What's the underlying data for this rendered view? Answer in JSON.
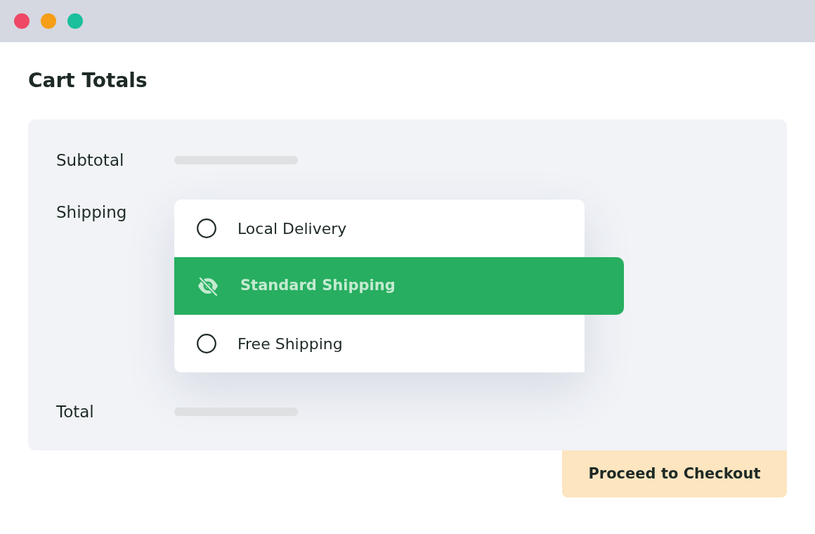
{
  "window": {
    "buttons": [
      {
        "color": "#ee4865"
      },
      {
        "color": "#f59e16"
      },
      {
        "color": "#1abf9c"
      }
    ]
  },
  "heading": "Cart Totals",
  "rows": [
    {
      "kind": "placeholder",
      "label": "Subtotal"
    },
    {
      "kind": "options",
      "label": "Shipping",
      "options": [
        {
          "label": "Local Delivery",
          "selected": false
        },
        {
          "label": "Standard Shipping",
          "selected": true
        },
        {
          "label": "Free Shipping",
          "selected": false
        }
      ]
    },
    {
      "kind": "placeholder",
      "label": "Total"
    }
  ],
  "button": "Proceed to Checkout"
}
